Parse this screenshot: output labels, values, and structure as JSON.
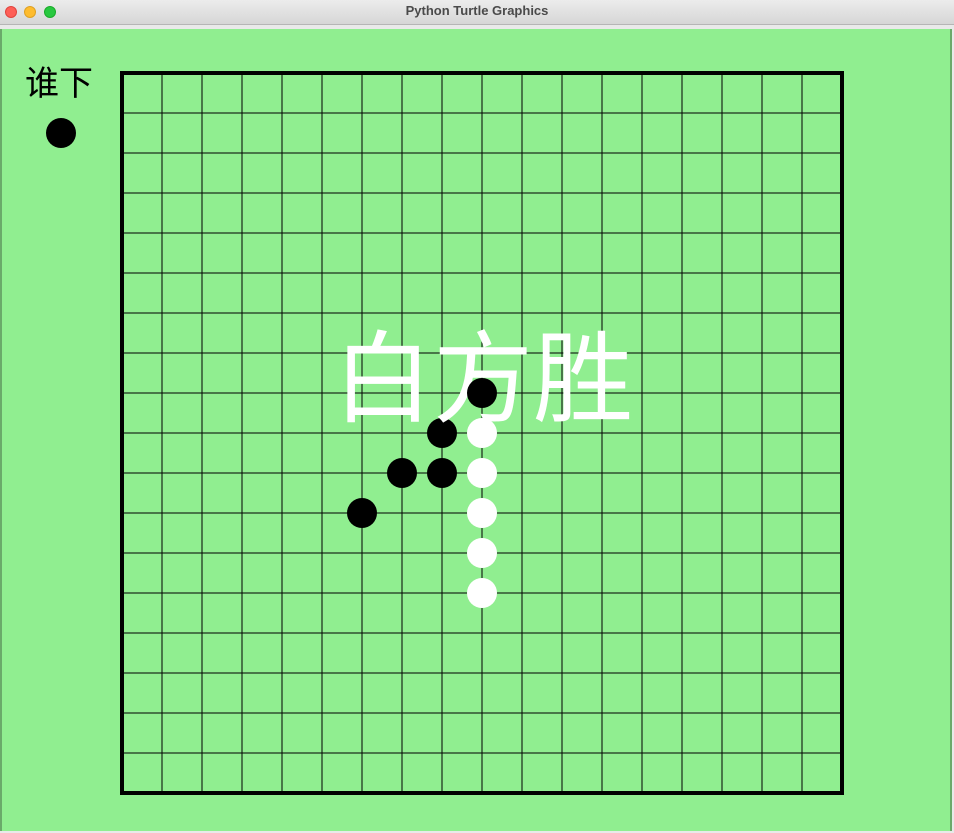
{
  "window": {
    "title": "Python Turtle Graphics",
    "buttons": [
      "close",
      "minimize",
      "zoom"
    ]
  },
  "game": {
    "board_size": 19,
    "background_color": "#90ee90",
    "grid_color": "#000000",
    "turn_label": "谁下",
    "current_turn_stone": "black",
    "winner_text": "白方胜",
    "winner_text_color": "#ffffff",
    "stones": [
      {
        "col": 9,
        "row": 8,
        "color": "black"
      },
      {
        "col": 8,
        "row": 9,
        "color": "black"
      },
      {
        "col": 7,
        "row": 10,
        "color": "black"
      },
      {
        "col": 8,
        "row": 10,
        "color": "black"
      },
      {
        "col": 6,
        "row": 11,
        "color": "black"
      },
      {
        "col": 9,
        "row": 9,
        "color": "white"
      },
      {
        "col": 9,
        "row": 10,
        "color": "white"
      },
      {
        "col": 9,
        "row": 11,
        "color": "white"
      },
      {
        "col": 9,
        "row": 12,
        "color": "white"
      },
      {
        "col": 9,
        "row": 13,
        "color": "white"
      }
    ]
  }
}
